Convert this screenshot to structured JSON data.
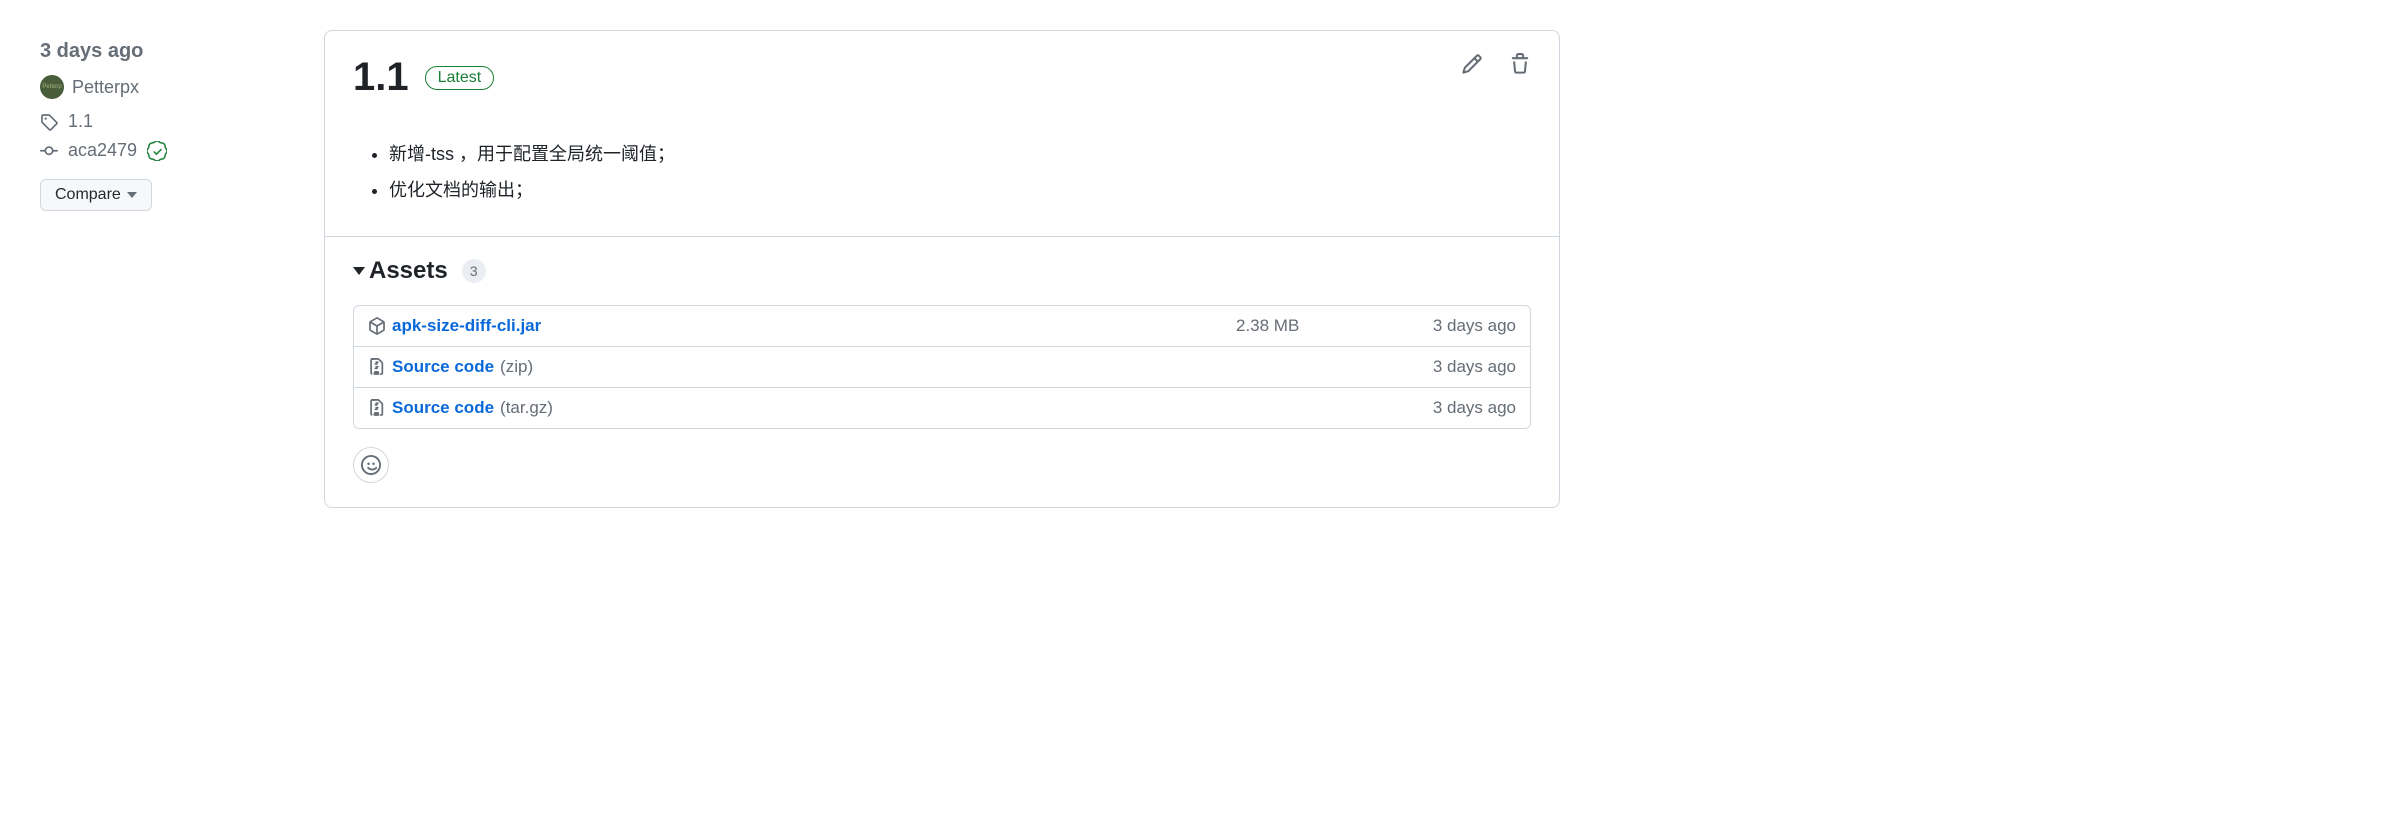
{
  "sidebar": {
    "timestamp": "3 days ago",
    "author": "Petterpx",
    "tag": "1.1",
    "commit": "aca2479",
    "compare_label": "Compare"
  },
  "release": {
    "title": "1.1",
    "latest_label": "Latest",
    "notes": [
      "新增-tss ，用于配置全局统一阈值；",
      "优化文档的输出；"
    ]
  },
  "assets": {
    "header": "Assets",
    "count": "3",
    "items": [
      {
        "name": "apk-size-diff-cli.jar",
        "suffix": "",
        "size": "2.38 MB",
        "time": "3 days ago",
        "icon": "package"
      },
      {
        "name": "Source code",
        "suffix": "(zip)",
        "size": "",
        "time": "3 days ago",
        "icon": "zip"
      },
      {
        "name": "Source code",
        "suffix": "(tar.gz)",
        "size": "",
        "time": "3 days ago",
        "icon": "zip"
      }
    ]
  }
}
